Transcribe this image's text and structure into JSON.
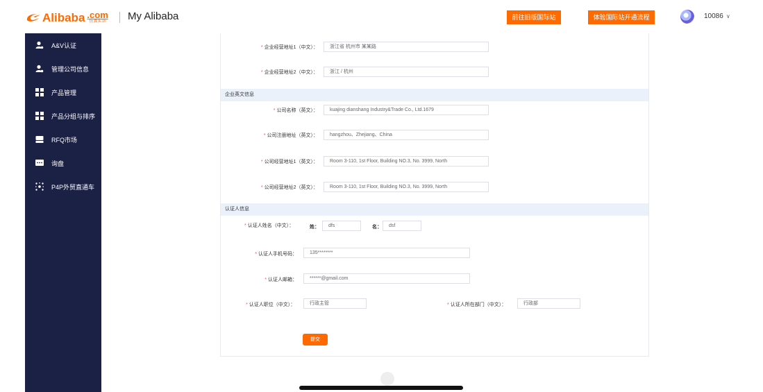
{
  "header": {
    "logo_text": "Alibaba",
    "logo_com": ".com",
    "logo_sub": "仿真实训",
    "title": "My Alibaba",
    "btn_old_site": "前往旧版国际站",
    "btn_flow": "体验国际站开通流程",
    "username": "10086",
    "user_menu_icon": "chevron-down-icon"
  },
  "sidebar": {
    "items": [
      {
        "label": "A&V认证",
        "icon": "user-icon"
      },
      {
        "label": "管理公司信息",
        "icon": "user-icon"
      },
      {
        "label": "产品管理",
        "icon": "grid-icon"
      },
      {
        "label": "产品分组与排序",
        "icon": "grid-icon"
      },
      {
        "label": "RFQ市场",
        "icon": "inbox-icon"
      },
      {
        "label": "询盘",
        "icon": "chat-icon"
      },
      {
        "label": "P4P外贸直通车",
        "icon": "network-icon"
      }
    ]
  },
  "form": {
    "address_cn_1": {
      "label": "企业经营地址1（中文）：",
      "value": "浙江省 杭州市 某某路"
    },
    "address_cn_2": {
      "label": "企业经营地址2（中文）：",
      "value": "浙江 / 杭州"
    },
    "section_english": "企业英文信息",
    "company_name_en": {
      "label": "公司名称（英文）：",
      "value": "kuajing dianshang Industry&Trade Co., Ltd.1679"
    },
    "reg_address_en": {
      "label": "公司注册地址（英文）：",
      "value": "hangzhou、Zhejiang、China"
    },
    "biz_address_en_1": {
      "label": "公司经营地址1（英文）：",
      "value": "Room 3-110, 1st Floor, Building NO.3, No. 3999, North"
    },
    "biz_address_en_2": {
      "label": "公司经营地址2（英文）：",
      "value": "Room 3-110, 1st Floor, Building NO.3, No. 3999, North"
    },
    "section_verifier": "认证人信息",
    "verifier_name": {
      "label": "认证人姓名（中文）：",
      "surname_label": "姓：",
      "surname": "dfs",
      "given_label": "名：",
      "given": "dsf"
    },
    "verifier_phone": {
      "label": "认证人手机号码：",
      "value": "135********"
    },
    "verifier_email": {
      "label": "认证人邮箱：",
      "value": "******@gmail.com"
    },
    "verifier_position": {
      "label": "认证人职位（中文）：",
      "value": "行政主管"
    },
    "verifier_dept": {
      "label": "认证人所在部门（中文）：",
      "value": "行政部"
    },
    "submit_label": "提交"
  },
  "colors": {
    "accent": "#ff6a00",
    "sidebar_bg": "#1b2045",
    "band_bg": "#eaf1fb",
    "required_star": "#ff4d4f"
  }
}
